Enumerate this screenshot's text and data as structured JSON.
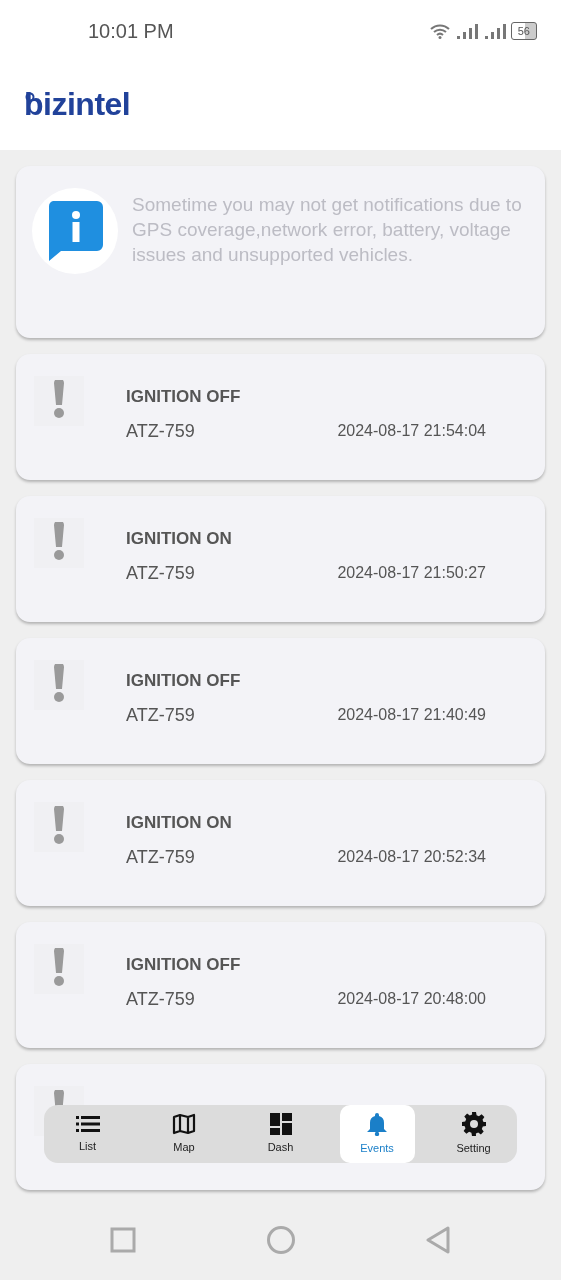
{
  "status_bar": {
    "time": "10:01 PM",
    "battery": "56"
  },
  "logo": "bizintel",
  "notice": {
    "text": "Sometime you may not get notifications due to GPS coverage,network error, battery, voltage issues and unsupported vehicles."
  },
  "events": [
    {
      "title": "IGNITION OFF",
      "vehicle": "ATZ-759",
      "time": "2024-08-17 21:54:04"
    },
    {
      "title": "IGNITION ON",
      "vehicle": "ATZ-759",
      "time": "2024-08-17 21:50:27"
    },
    {
      "title": "IGNITION OFF",
      "vehicle": "ATZ-759",
      "time": "2024-08-17 21:40:49"
    },
    {
      "title": "IGNITION ON",
      "vehicle": "ATZ-759",
      "time": "2024-08-17 20:52:34"
    },
    {
      "title": "IGNITION OFF",
      "vehicle": "ATZ-759",
      "time": "2024-08-17 20:48:00"
    }
  ],
  "bottom_nav": [
    {
      "label": "List",
      "selected": false
    },
    {
      "label": "Map",
      "selected": false
    },
    {
      "label": "Dash",
      "selected": false
    },
    {
      "label": "Events",
      "selected": true
    },
    {
      "label": "Setting",
      "selected": false
    }
  ]
}
